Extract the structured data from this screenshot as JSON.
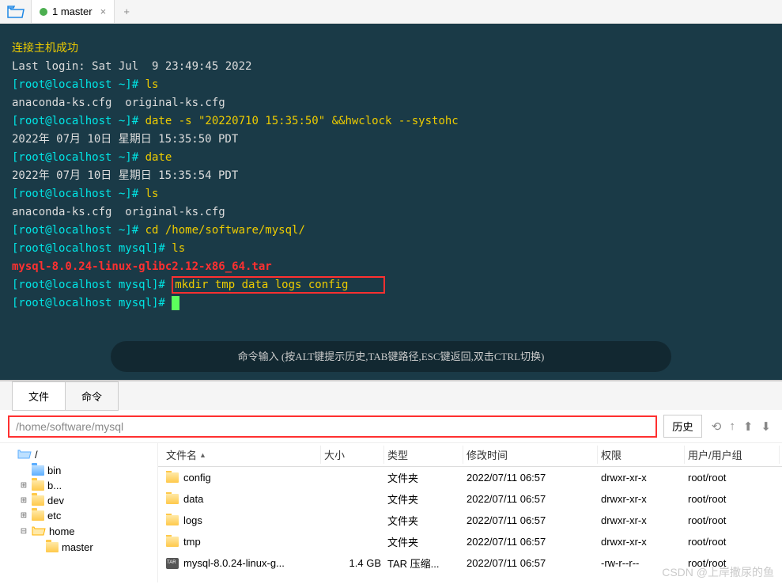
{
  "tab": {
    "label": "1 master"
  },
  "terminal": {
    "success": "连接主机成功",
    "lastlogin": "Last login: Sat Jul  9 23:49:45 2022",
    "p1": "[root@localhost ~]# ",
    "p2": "[root@localhost mysql]# ",
    "c_ls": "ls",
    "out1": "anaconda-ks.cfg  original-ks.cfg",
    "c_date_set": "date -s \"20220710 15:35:50\" &&hwclock --systohc",
    "out2": "2022年 07月 10日 星期日 15:35:50 PDT",
    "c_date": "date",
    "out3": "2022年 07月 10日 星期日 15:35:54 PDT",
    "c_cd": "cd /home/software/mysql/",
    "tarfile": "mysql-8.0.24-linux-glibc2.12-x86_64.tar",
    "c_mkdir": "mkdir tmp data logs config",
    "hint": "命令输入 (按ALT键提示历史,TAB键路径,ESC键返回,双击CTRL切换)"
  },
  "bottom_tabs": {
    "file": "文件",
    "cmd": "命令"
  },
  "path": "/home/software/mysql",
  "history_btn": "历史",
  "columns": {
    "name": "文件名",
    "size": "大小",
    "type": "类型",
    "mtime": "修改时间",
    "perm": "权限",
    "owner": "用户/用户组"
  },
  "tree": [
    {
      "exp": "",
      "indent": 0,
      "label": "/",
      "cls": "open-folder-root"
    },
    {
      "exp": "",
      "indent": 1,
      "label": "bin",
      "cls": "blue-f"
    },
    {
      "exp": "⊞",
      "indent": 1,
      "label": "b...",
      "cls": "yellow-f"
    },
    {
      "exp": "⊞",
      "indent": 1,
      "label": "dev",
      "cls": "yellow-f"
    },
    {
      "exp": "⊞",
      "indent": 1,
      "label": "etc",
      "cls": "yellow-f"
    },
    {
      "exp": "⊟",
      "indent": 1,
      "label": "home",
      "cls": "open-folder"
    },
    {
      "exp": "",
      "indent": 2,
      "label": "master",
      "cls": "yellow-f"
    }
  ],
  "files": [
    {
      "name": "config",
      "icon": "folder",
      "size": "",
      "type": "文件夹",
      "mtime": "2022/07/11 06:57",
      "perm": "drwxr-xr-x",
      "owner": "root/root"
    },
    {
      "name": "data",
      "icon": "folder",
      "size": "",
      "type": "文件夹",
      "mtime": "2022/07/11 06:57",
      "perm": "drwxr-xr-x",
      "owner": "root/root"
    },
    {
      "name": "logs",
      "icon": "folder",
      "size": "",
      "type": "文件夹",
      "mtime": "2022/07/11 06:57",
      "perm": "drwxr-xr-x",
      "owner": "root/root"
    },
    {
      "name": "tmp",
      "icon": "folder",
      "size": "",
      "type": "文件夹",
      "mtime": "2022/07/11 06:57",
      "perm": "drwxr-xr-x",
      "owner": "root/root"
    },
    {
      "name": "mysql-8.0.24-linux-g...",
      "icon": "tar",
      "size": "1.4 GB",
      "type": "TAR 压缩...",
      "mtime": "2022/07/11 06:57",
      "perm": "-rw-r--r--",
      "owner": "root/root"
    }
  ],
  "watermark": "CSDN @上岸撒尿的鱼"
}
